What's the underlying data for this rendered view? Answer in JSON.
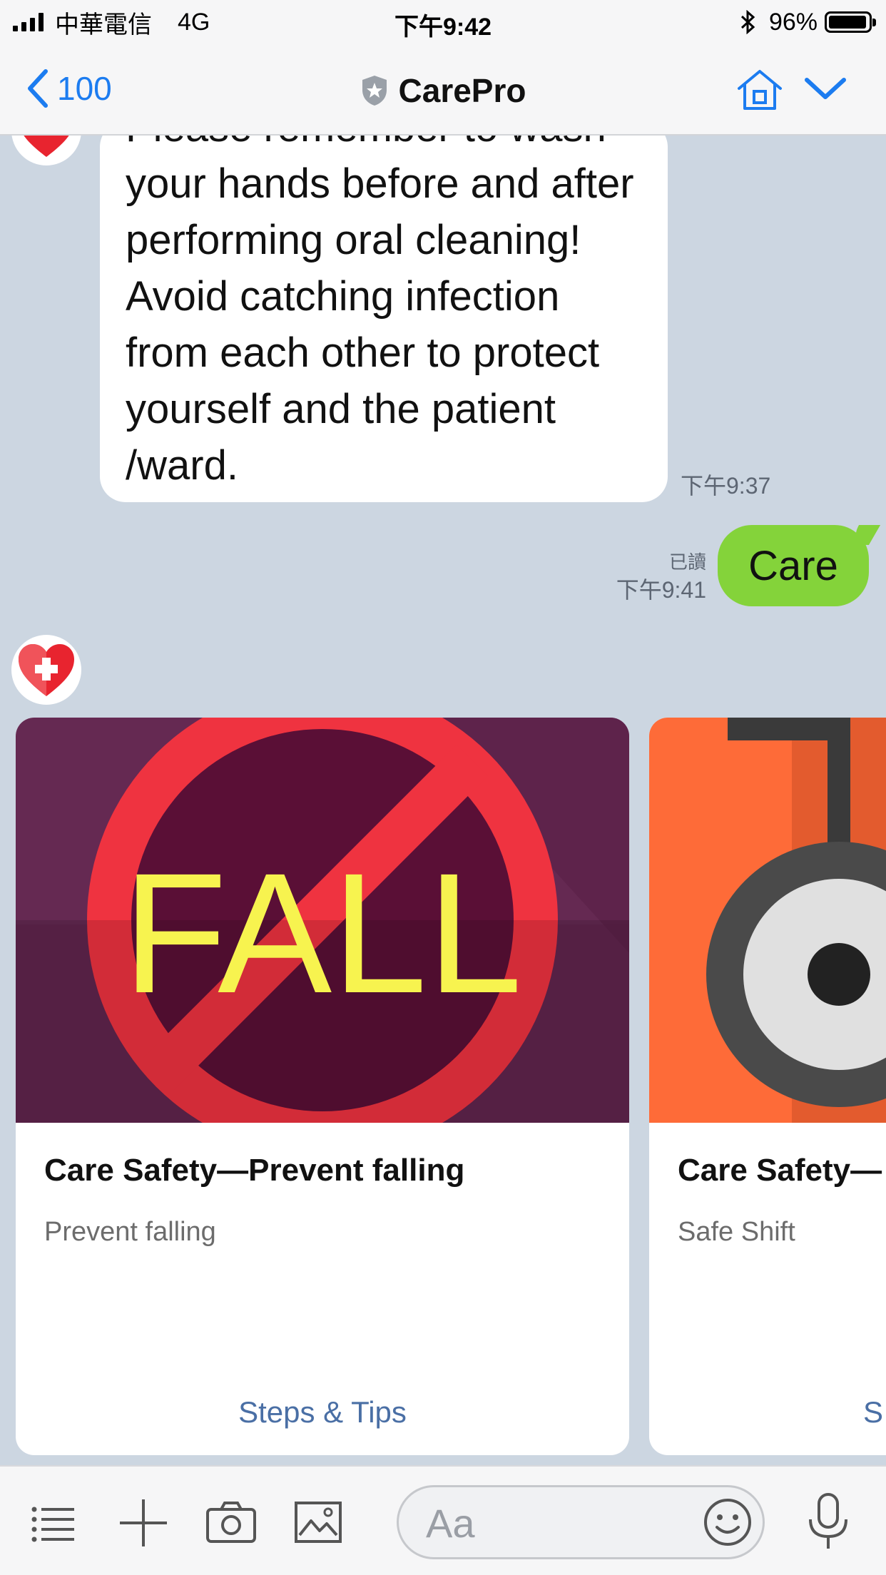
{
  "status_bar": {
    "carrier": "中華電信",
    "network": "4G",
    "time": "下午9:42",
    "battery": "96%",
    "battery_level": 0.96
  },
  "nav": {
    "back_label": "100",
    "title": "CarePro",
    "icons": [
      "back-chevron-icon",
      "shield-star-icon",
      "home-icon",
      "chevron-down-icon"
    ]
  },
  "messages": {
    "incoming_text": "Please remember to wash your hands before and after performing oral cleaning! Avoid catching infection from each other to protect yourself and the patient /ward.",
    "incoming_time": "下午9:37",
    "outgoing_text": "Care",
    "outgoing_read": "已讀",
    "outgoing_time": "下午9:41"
  },
  "cards": [
    {
      "image_text": "FALL",
      "title": "Care Safety—Prevent falling",
      "subtitle": "Prevent falling",
      "action": "Steps & Tips"
    },
    {
      "title": "Care Safety—",
      "subtitle": "Safe Shift",
      "action": "S"
    }
  ],
  "input_bar": {
    "placeholder": "Aa",
    "icons": [
      "menu-icon",
      "plus-icon",
      "camera-icon",
      "image-icon",
      "emoji-icon",
      "microphone-icon"
    ]
  },
  "colors": {
    "chat_background": "#ccd6e1",
    "outgoing_bubble": "#84d33a",
    "link_blue": "#1c7cf0",
    "card1_background": "#652952",
    "card2_background": "#fe6b38"
  }
}
